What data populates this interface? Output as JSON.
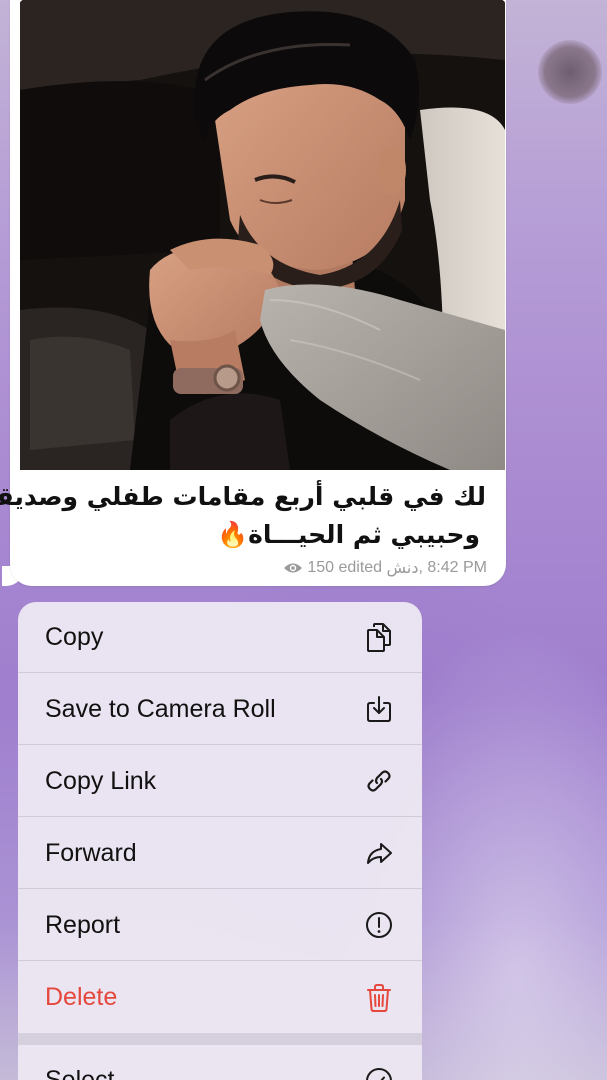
{
  "message": {
    "caption_line1": "لك في قلبي أربع مقامات طفلي وصديقي",
    "caption_line2": "وحبيبي ثم الحيـــاة🔥",
    "views": "150",
    "edited_label": "edited",
    "author": "دنش",
    "time": "8:42 PM"
  },
  "context_menu": {
    "items": [
      {
        "label": "Copy",
        "icon": "copy-icon"
      },
      {
        "label": "Save to Camera Roll",
        "icon": "save-download-icon"
      },
      {
        "label": "Copy Link",
        "icon": "link-icon"
      },
      {
        "label": "Forward",
        "icon": "forward-arrow-icon"
      },
      {
        "label": "Report",
        "icon": "report-exclamation-icon"
      },
      {
        "label": "Delete",
        "icon": "trash-icon",
        "color": "#e5483d"
      }
    ],
    "secondary_items": [
      {
        "label": "Select",
        "icon": "checkmark-circle-icon"
      }
    ]
  },
  "colors": {
    "danger": "#e5483d",
    "menu_bg": "#ece6f2",
    "meta_text": "#9a9a9a"
  }
}
